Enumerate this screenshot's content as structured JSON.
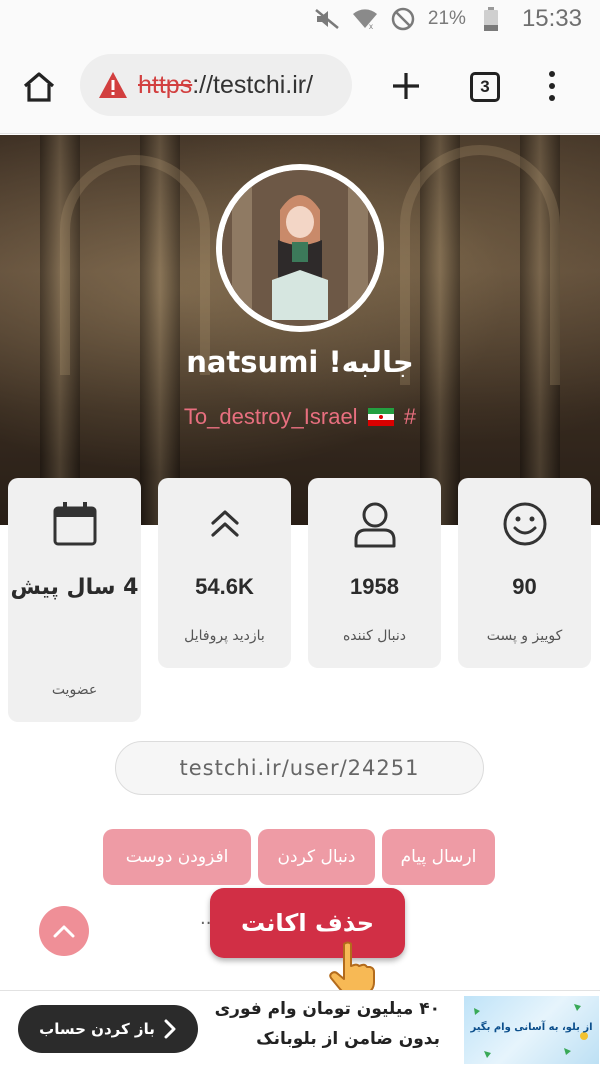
{
  "status_bar": {
    "battery_percent": "21%",
    "time": "15:33",
    "icons": [
      "mute-icon",
      "wifi-icon",
      "do-not-disturb-icon",
      "battery-icon"
    ]
  },
  "browser": {
    "url_scheme": "https",
    "url_rest": "://testchi.ir/",
    "tab_count": "3",
    "icons": [
      "home-icon",
      "warning-icon",
      "plus-icon",
      "tabs-icon",
      "more-vert-icon"
    ]
  },
  "profile": {
    "username": "جالبه! natsumi",
    "hashtag_text": "To_destroy_Israel",
    "hashtag_symbol": "#",
    "flag": "iran-flag"
  },
  "stats": {
    "posts": {
      "value": "90",
      "label": "کوییز و پست",
      "icon": "smiley-icon"
    },
    "followers": {
      "value": "1958",
      "label": "دنبال کننده",
      "icon": "user-icon"
    },
    "views": {
      "value": "54.6K",
      "label": "بازدید پروفایل",
      "icon": "chevrons-up-icon"
    },
    "membership": {
      "value": "4 سال پیش",
      "label": "عضویت",
      "icon": "calendar-icon"
    }
  },
  "profile_link": "testchi.ir/user/24251",
  "actions": {
    "message": "ارسال پیام",
    "follow": "دنبال کردن",
    "add_friend": "افزودن دوست"
  },
  "ellipsis": "..",
  "delete_account": "حذف اکانت",
  "ad": {
    "title": "۴۰ میلیون تومان وام فوری",
    "subtitle": "بدون ضامن از بلوبانک",
    "cta": "باز کردن حساب",
    "image_text": "از بلو، به آسانی وام بگیر"
  },
  "colors": {
    "accent_pink": "#ee9ba5",
    "delete_red": "#d12f45",
    "hashtag_pink": "#e86f7f",
    "card_bg": "#f0f0f0"
  }
}
